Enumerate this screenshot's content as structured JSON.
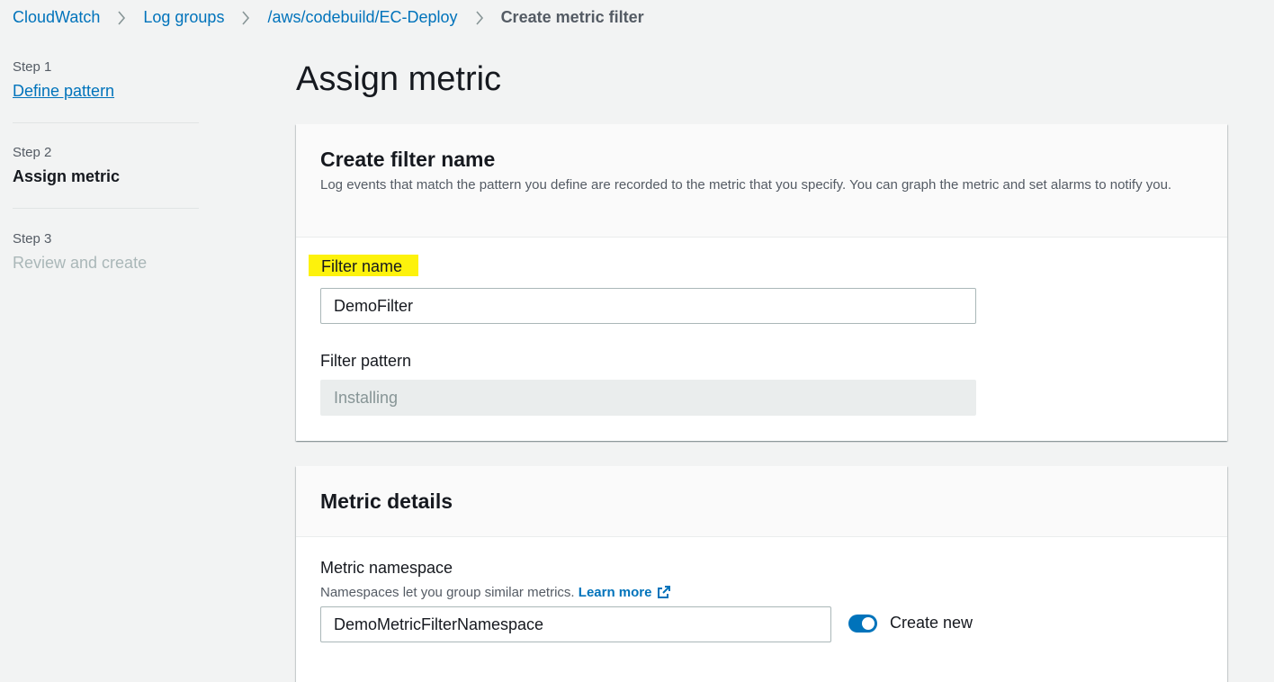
{
  "breadcrumb": {
    "items": [
      "CloudWatch",
      "Log groups",
      "/aws/codebuild/EC-Deploy"
    ],
    "current": "Create metric filter"
  },
  "steps": [
    {
      "number": "Step 1",
      "title": "Define pattern"
    },
    {
      "number": "Step 2",
      "title": "Assign metric"
    },
    {
      "number": "Step 3",
      "title": "Review and create"
    }
  ],
  "page_title": "Assign metric",
  "filter_panel": {
    "title": "Create filter name",
    "description": "Log events that match the pattern you define are recorded to the metric that you specify. You can graph the metric and set alarms to notify you.",
    "filter_name_label": "Filter name",
    "filter_name_value": "DemoFilter",
    "filter_pattern_label": "Filter pattern",
    "filter_pattern_value": "Installing"
  },
  "metric_panel": {
    "title": "Metric details",
    "namespace_label": "Metric namespace",
    "namespace_help": "Namespaces let you group similar metrics.",
    "learn_more": "Learn more",
    "namespace_value": "DemoMetricFilterNamespace",
    "create_new_label": "Create new",
    "create_new_on": true
  },
  "colors": {
    "accent": "#0073bb",
    "highlight": "#fdf20c"
  }
}
